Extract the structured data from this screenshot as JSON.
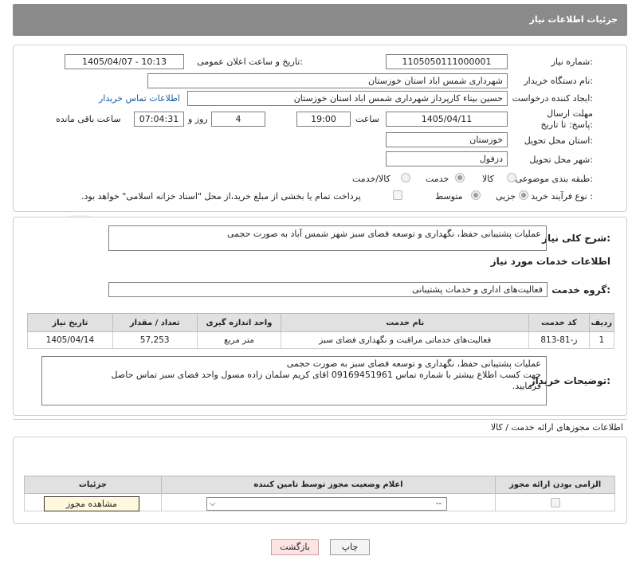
{
  "header": {
    "title": "جزئیات اطلاعات نیاز"
  },
  "form": {
    "need_number": {
      "label": "شماره نیاز:",
      "value": "1105050111000001"
    },
    "announce_datetime": {
      "label": "تاریخ و ساعت اعلان عمومی:",
      "value": "1405/04/07 - 10:13"
    },
    "buyer_org": {
      "label": "نام دستگاه خریدار:",
      "value": "شهرداری شمس اباد استان خوزستان"
    },
    "requester": {
      "label": "ایجاد کننده درخواست:",
      "value": "حسین بیناء کارپرداز شهرداری شمس اباد استان خوزستان",
      "contact_link": "اطلاعات تماس خریدار"
    },
    "deadline": {
      "label": "مهلت ارسال پاسخ: تا تاریخ:",
      "date": "1405/04/11",
      "time_label": "ساعت",
      "time": "19:00",
      "days": "4",
      "days_label": "روز و",
      "remaining": "07:04:31",
      "remaining_label": "ساعت باقی مانده"
    },
    "province": {
      "label": "استان محل تحویل:",
      "value": "خوزستان"
    },
    "city": {
      "label": "شهر محل تحویل:",
      "value": "دزفول"
    },
    "category": {
      "label": "طبقه بندی موضوعی:",
      "options": [
        "کالا",
        "خدمت",
        "کالا/خدمت"
      ],
      "selected": "خدمت"
    },
    "purchase_type": {
      "label": "نوع فرآیند خرید :",
      "options": [
        "جزیی",
        "متوسط"
      ],
      "selected": "جزیی",
      "treasury_note": "پرداخت تمام یا بخشی از مبلغ خرید،از محل \"اسناد خزانه اسلامی\" خواهد بود."
    }
  },
  "summary": {
    "label": "شرح کلی نیاز:",
    "value": "عملیات پشتیبانی حفظ، نگهداری و توسعه فضای سبز شهر شمس آباد به صورت حجمی"
  },
  "services": {
    "title": "اطلاعات خدمات مورد نیاز",
    "group_label": "گروه خدمت:",
    "group_value": "فعالیت‌های اداری و خدمات پشتیبانی",
    "table": {
      "headers": [
        "ردیف",
        "کد خدمت",
        "نام خدمت",
        "واحد اندازه گیری",
        "تعداد / مقدار",
        "تاریخ نیاز"
      ],
      "rows": [
        [
          "1",
          "ز-81-813",
          "فعالیت‌های خدماتی مراقبت و نگهداری فضای سبز",
          "متر مربع",
          "57,253",
          "1405/04/14"
        ]
      ]
    }
  },
  "buyer_notes": {
    "label": "توضیحات خریدار:",
    "lines": [
      "عملیات پشتیبانی حفظ، نگهداری و توسعه فضای سبز به صورت حجمی",
      "جهت کسب اطلاع بیشتر با شماره تماس 09169451961 اقای کریم سلمان زاده مسول واحد فضای سبز تماس حاصل",
      "فرمایید."
    ]
  },
  "permits": {
    "title": "اطلاعات مجوزهای ارائه خدمت / کالا",
    "headers": [
      "الزامی بودن ارائه مجوز",
      "اعلام وضعیت مجوز توسط تامین کننده",
      "جزئیات"
    ],
    "select_value": "--",
    "view_button": "مشاهده مجوز"
  },
  "footer": {
    "print_button": "چاپ",
    "back_button": "بازگشت"
  },
  "watermark": {
    "text": "AriaTender.net"
  },
  "colors": {
    "header_bg": "#8a8a8a",
    "link": "#1b5aa6",
    "back_button_bg": "#fde3e3",
    "view_button_bg": "#fff8dc"
  }
}
